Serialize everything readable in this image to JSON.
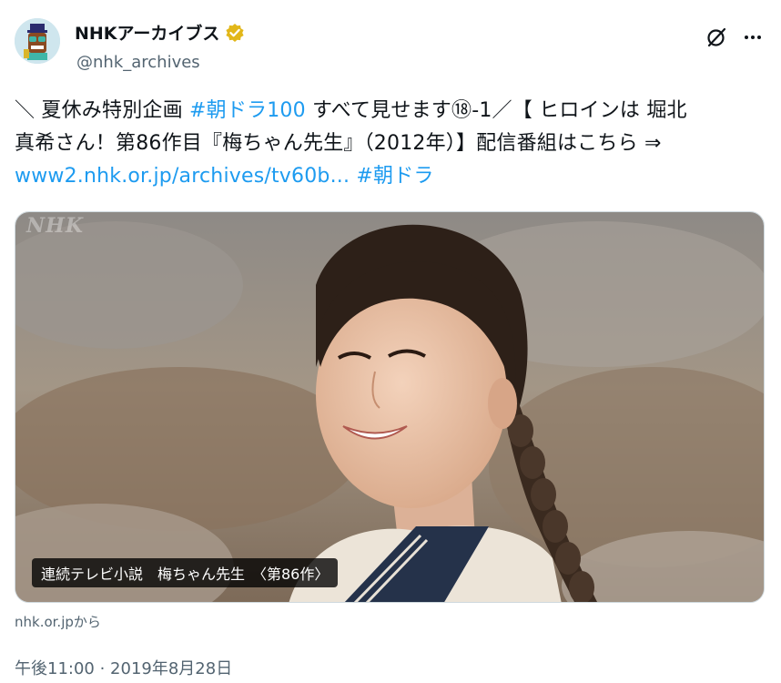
{
  "author": {
    "display_name": "NHKアーカイブス",
    "handle": "@nhk_archives",
    "verified_color": "#e2b719"
  },
  "tweet": {
    "line1_a": "＼ 夏休み特別企画 ",
    "line1_hashtag": "#朝ドラ100",
    "line1_b": " すべて見せます⑱-1／【 ヒロインは 堀北",
    "line2": "真希さん！第86作目『梅ちゃん先生』（2012年）】配信番組はこちら ⇒",
    "line3_link": "www2.nhk.or.jp/archives/tv60b...",
    "line3_space": " ",
    "line3_hashtag": "#朝ドラ"
  },
  "media": {
    "watermark": "NHK",
    "caption": "連続テレビ小説　梅ちゃん先生　〈第86作〉"
  },
  "source": "nhk.or.jpから",
  "timestamp": "午後11:00 · 2019年8月28日",
  "colors": {
    "link": "#1d9bf0",
    "muted": "#536471",
    "text": "#0f1419"
  },
  "icons": [
    "avatar-domo-icon",
    "verified-badge-icon",
    "grok-icon",
    "more-icon"
  ]
}
